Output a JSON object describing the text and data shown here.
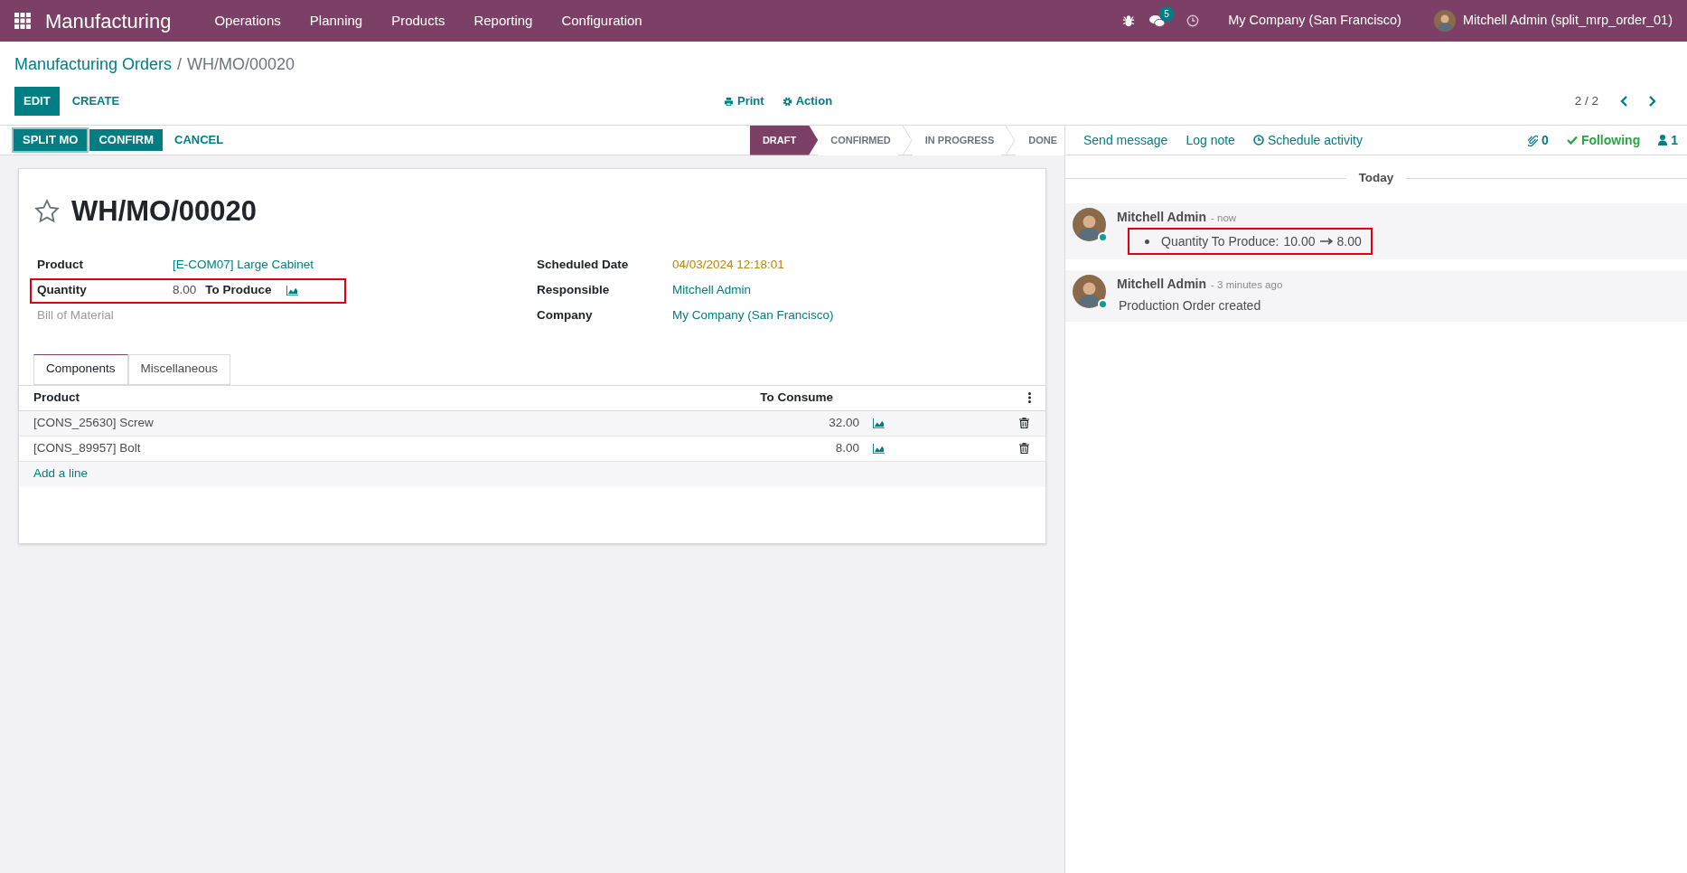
{
  "navbar": {
    "app": "Manufacturing",
    "menus": [
      "Operations",
      "Planning",
      "Products",
      "Reporting",
      "Configuration"
    ],
    "messages_count": "5",
    "company": "My Company (San Francisco)",
    "user": "Mitchell Admin (split_mrp_order_01)"
  },
  "breadcrumb": {
    "parent": "Manufacturing Orders",
    "separator": "/",
    "current": "WH/MO/00020"
  },
  "control_buttons": [
    {
      "label": "EDIT",
      "kind": "primary"
    },
    {
      "label": "CREATE",
      "kind": "link"
    }
  ],
  "actions": [
    {
      "label": "Print",
      "kind": "print"
    },
    {
      "label": "Action",
      "kind": "gear"
    }
  ],
  "pager": "2 / 2",
  "header_buttons": [
    {
      "label": "SPLIT MO",
      "kind": "primary",
      "focused": true
    },
    {
      "label": "CONFIRM",
      "kind": "primary",
      "focused": false
    },
    {
      "label": "CANCEL",
      "kind": "link",
      "focused": false
    }
  ],
  "stages": [
    {
      "label": "DRAFT",
      "selected": true
    },
    {
      "label": "CONFIRMED",
      "selected": false
    },
    {
      "label": "IN PROGRESS",
      "selected": false
    },
    {
      "label": "DONE",
      "selected": false
    }
  ],
  "title": {
    "name": "WH/MO/00020",
    "starred": false
  },
  "left_fields": [
    {
      "label": "Product",
      "kind": "link",
      "value": "[E-COM07] Large Cabinet",
      "highlighted": false
    },
    {
      "label": "Quantity",
      "kind": "quantity",
      "value": "8.00",
      "suffix": "To Produce",
      "highlighted": true
    },
    {
      "label": "Bill of Material",
      "kind": "empty",
      "highlighted": false
    }
  ],
  "right_fields": [
    {
      "label": "Scheduled Date",
      "kind": "date",
      "value": "04/03/2024 12:18:01"
    },
    {
      "label": "Responsible",
      "kind": "link",
      "value": "Mitchell Admin"
    },
    {
      "label": "Company",
      "kind": "link",
      "value": "My Company (San Francisco)"
    }
  ],
  "tabs": [
    {
      "label": "Components",
      "selected": true
    },
    {
      "label": "Miscellaneous",
      "selected": false
    }
  ],
  "table": {
    "columns": [
      "Product",
      "To Consume"
    ],
    "rows": [
      {
        "product": "[CONS_25630] Screw",
        "to_consume": "32.00"
      },
      {
        "product": "[CONS_89957] Bolt",
        "to_consume": "8.00"
      }
    ],
    "add_line": "Add a line"
  },
  "chatter": {
    "buttons": [
      {
        "label": "Send message",
        "kind": "plain"
      },
      {
        "label": "Log note",
        "kind": "plain"
      },
      {
        "label": "Schedule activity",
        "kind": "clock"
      }
    ],
    "attachments": "0",
    "following": "Following",
    "followers": "1",
    "date_separator": "Today",
    "messages": [
      {
        "author": "Mitchell Admin",
        "time": "- now",
        "kind": "tracking",
        "field": "Quantity To Produce:",
        "old": "10.00",
        "new": "8.00",
        "highlighted": true
      },
      {
        "author": "Mitchell Admin",
        "time": "- 3 minutes ago",
        "kind": "text",
        "body": "Production Order created",
        "highlighted": false
      }
    ]
  }
}
